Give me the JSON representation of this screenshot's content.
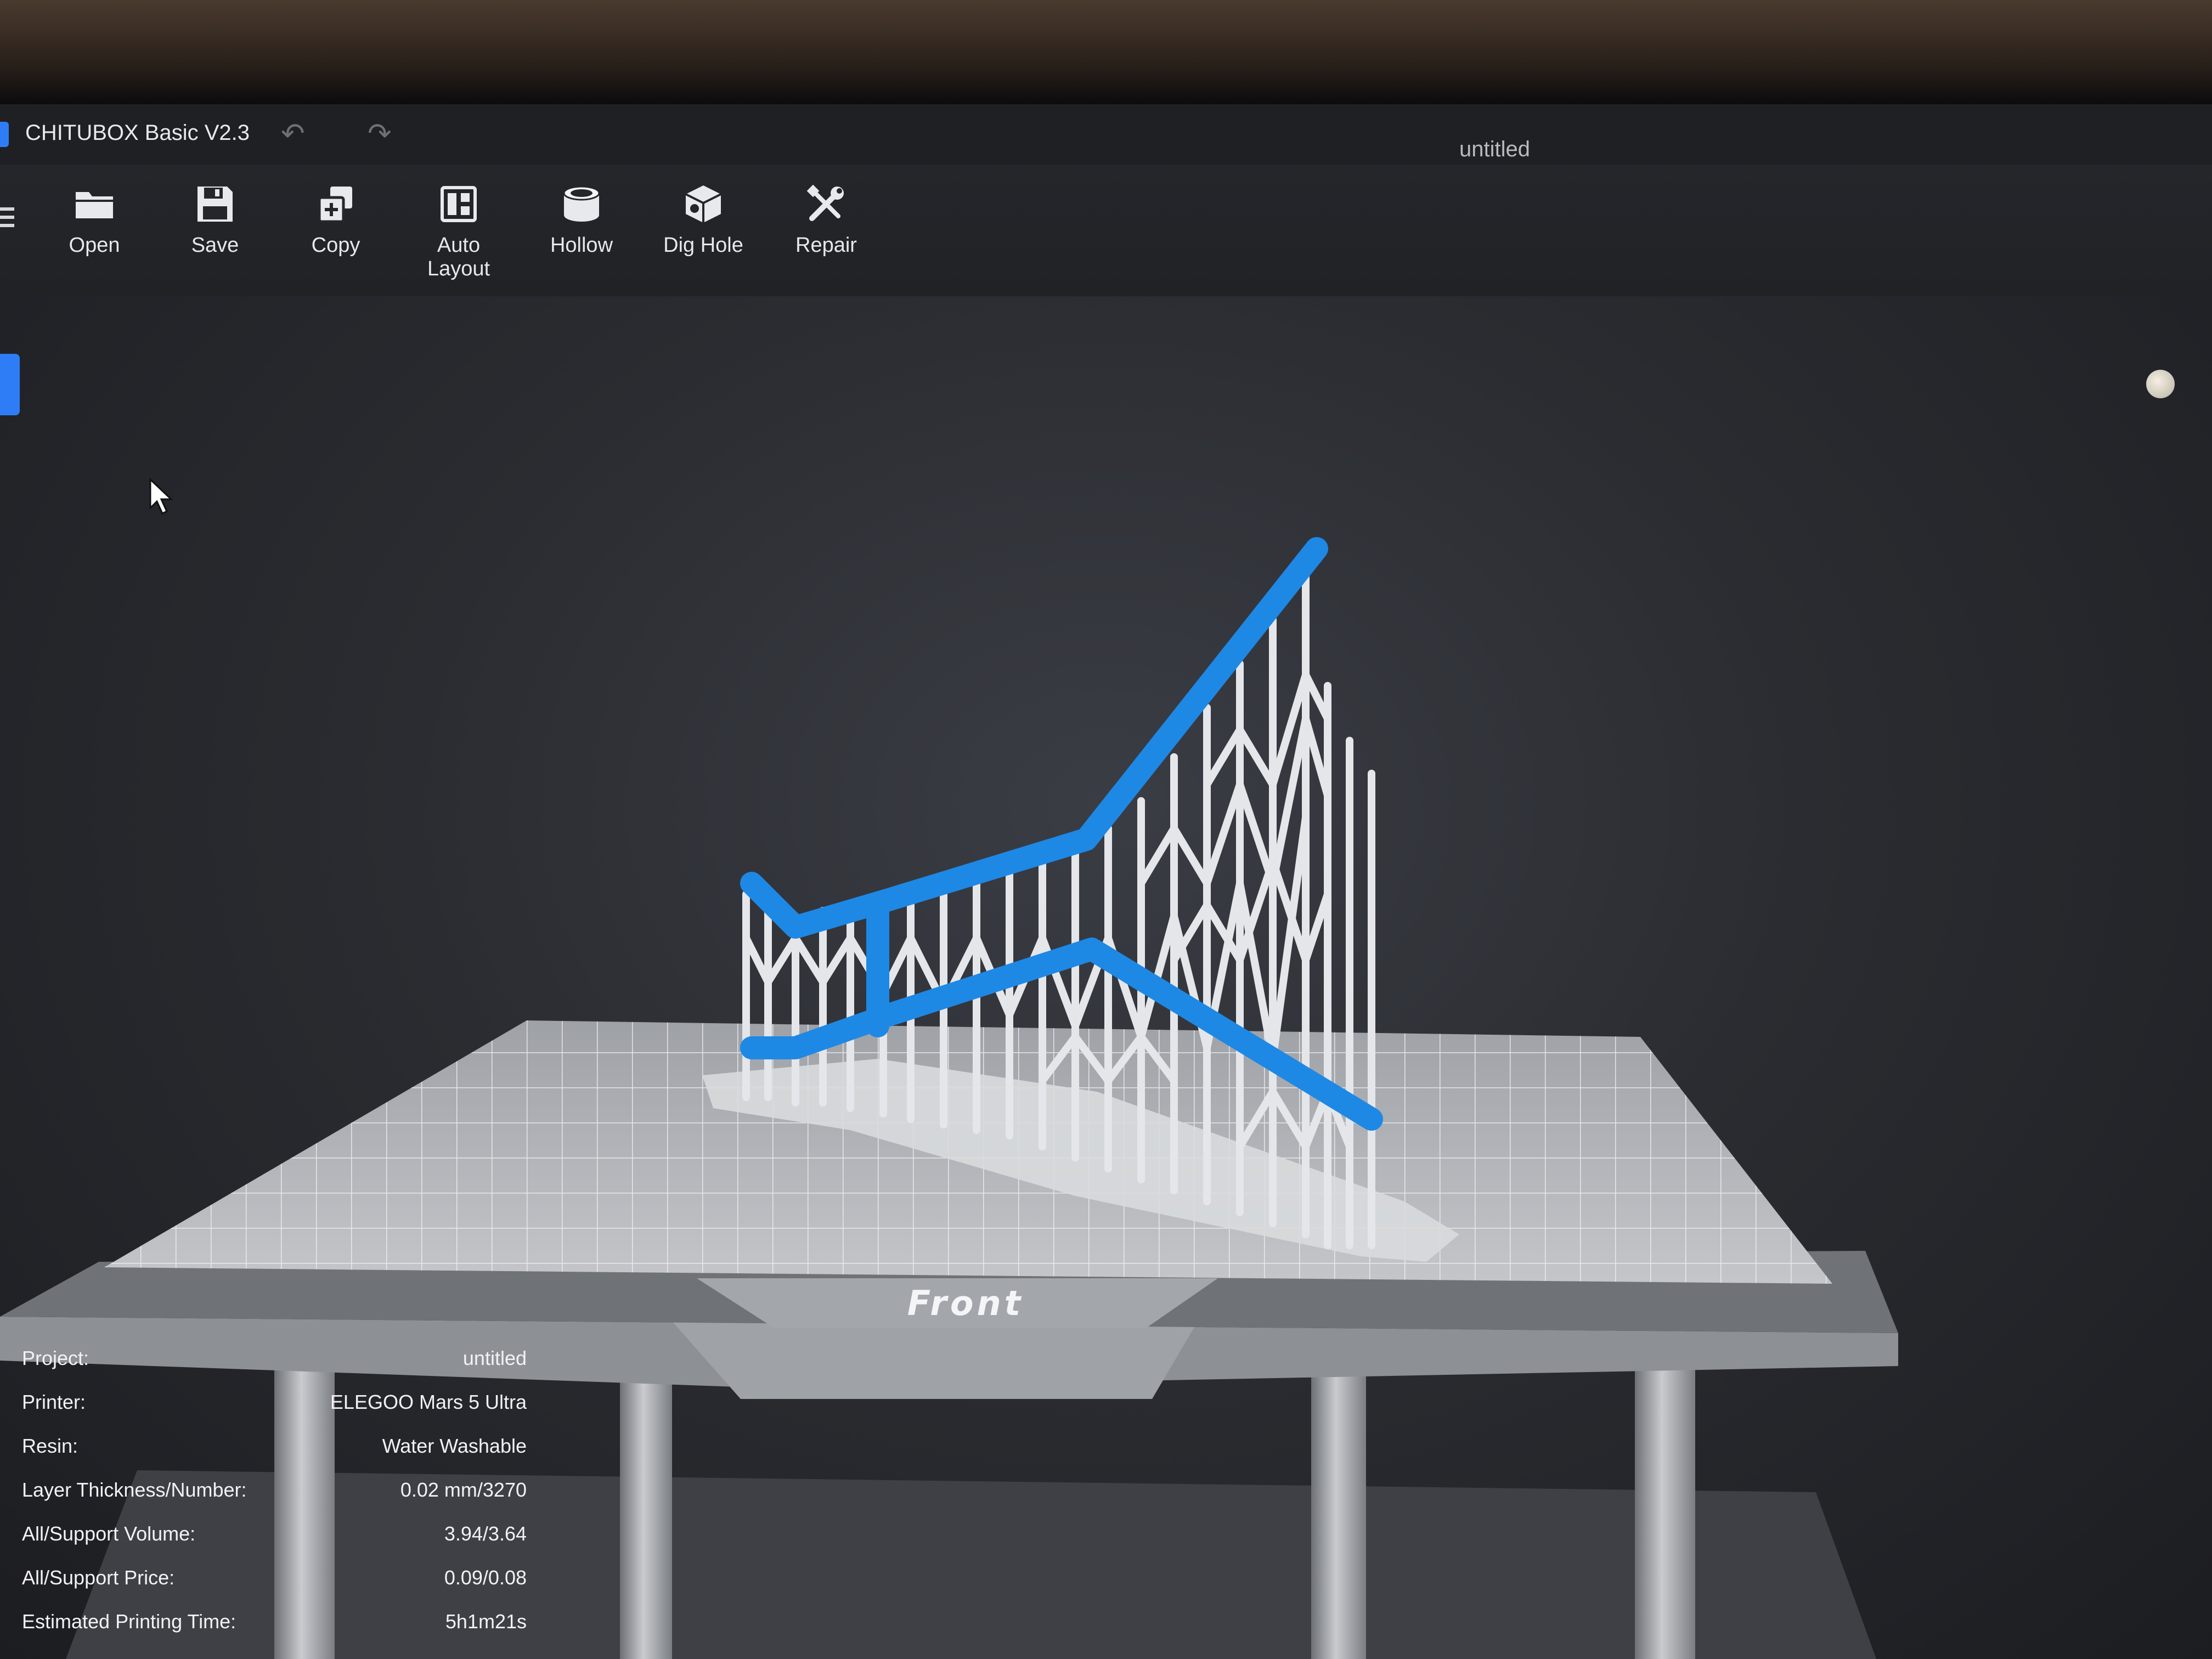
{
  "app": {
    "title": "CHITUBOX Basic V2.3",
    "window_title": "untitled"
  },
  "titlebar": {
    "undo_icon": "undo-icon",
    "redo_icon": "redo-icon"
  },
  "toolbar": {
    "items": [
      {
        "label": "Open",
        "icon": "folder-icon"
      },
      {
        "label": "Save",
        "icon": "floppy-disk-icon"
      },
      {
        "label": "Copy",
        "icon": "copy-plus-icon"
      },
      {
        "label": "Auto Layout",
        "icon": "layout-grid-icon"
      },
      {
        "label": "Hollow",
        "icon": "hollow-cylinder-icon"
      },
      {
        "label": "Dig Hole",
        "icon": "cube-hole-icon"
      },
      {
        "label": "Repair",
        "icon": "wrench-screwdriver-icon"
      }
    ]
  },
  "viewport": {
    "platform_label": "Front",
    "model_color": "#1e88e5",
    "support_color": "#e2e4e8",
    "plate_color": "#b6b8bc"
  },
  "info": {
    "rows": [
      {
        "label": "Project:",
        "value": "untitled"
      },
      {
        "label": "Printer:",
        "value": "ELEGOO Mars 5 Ultra"
      },
      {
        "label": "Resin:",
        "value": "Water Washable"
      },
      {
        "label": "Layer Thickness/Number:",
        "value": "0.02 mm/3270"
      },
      {
        "label": "All/Support Volume:",
        "value": "3.94/3.64"
      },
      {
        "label": "All/Support Price:",
        "value": "0.09/0.08"
      },
      {
        "label": "Estimated Printing Time:",
        "value": "5h1m21s"
      }
    ]
  }
}
